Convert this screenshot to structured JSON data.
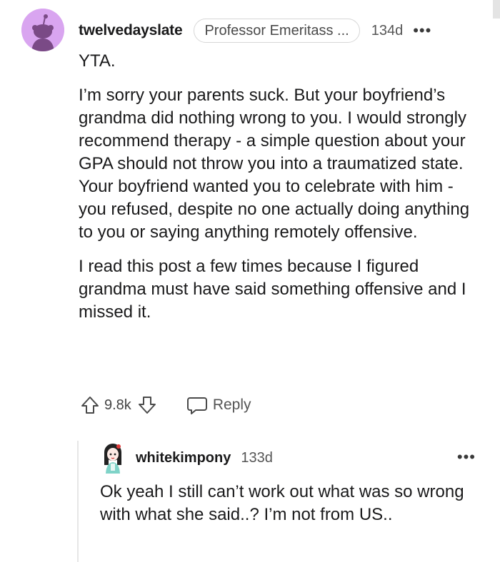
{
  "comment": {
    "username": "twelvedayslate",
    "flair": "Professor Emeritass ...",
    "time": "134d",
    "more_label": "•••",
    "avatar_icon": "snoo-avatar-icon",
    "avatar_color": "#d9a5f0",
    "paragraphs": [
      "YTA.",
      "I’m sorry your parents suck. But your boyfriend’s grandma did nothing wrong to you. I would strongly recommend therapy - a simple question about your GPA should not throw you into a traumatized state. Your boyfriend wanted you to celebrate with him - you refused, despite no one actually doing anything to you or saying anything remotely offensive.",
      "I read this post a few times because I figured grandma must have said something offensive and I missed it."
    ],
    "actions": {
      "upvote_icon": "upvote-arrow-icon",
      "score": "9.8k",
      "downvote_icon": "downvote-arrow-icon",
      "reply_icon": "speech-bubble-icon",
      "reply_label": "Reply"
    }
  },
  "reply": {
    "username": "whitekimpony",
    "time": "133d",
    "more_label": "•••",
    "avatar_icon": "character-avatar-icon",
    "body": "Ok yeah I still can’t work out what was so wrong with what she said..? I’m not from US.."
  }
}
